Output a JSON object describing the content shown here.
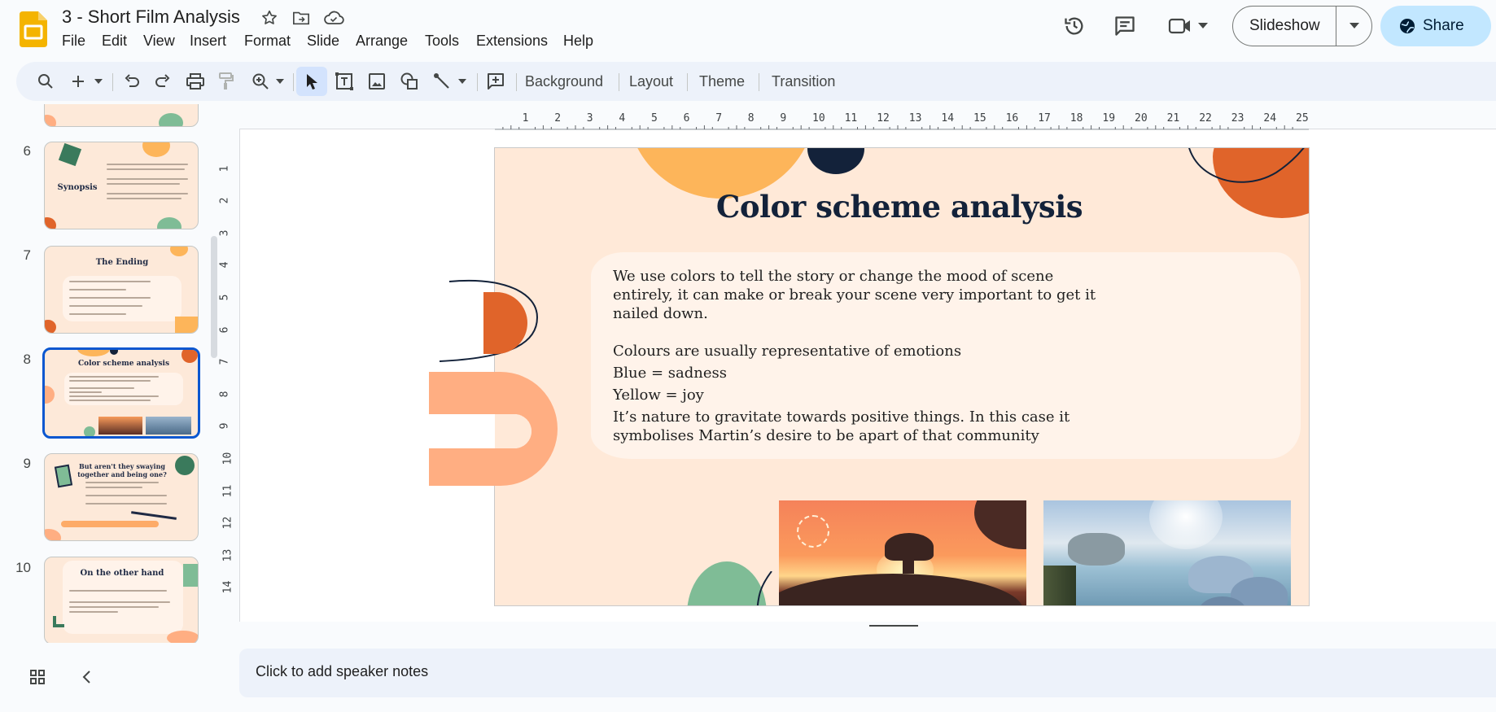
{
  "doc": {
    "title": "3 - Short Film Analysis"
  },
  "menu": [
    "File",
    "Edit",
    "View",
    "Insert",
    "Format",
    "Slide",
    "Arrange",
    "Tools",
    "Extensions",
    "Help"
  ],
  "header": {
    "slideshow_label": "Slideshow",
    "share_label": "Share"
  },
  "toolbar": {
    "background_label": "Background",
    "layout_label": "Layout",
    "theme_label": "Theme",
    "transition_label": "Transition"
  },
  "ruler": {
    "top_ticks": [
      "1",
      "2",
      "3",
      "4",
      "5",
      "6",
      "7",
      "8",
      "9",
      "10",
      "11",
      "12",
      "13",
      "14",
      "15",
      "16",
      "17",
      "18",
      "19",
      "20",
      "21",
      "22",
      "23",
      "24",
      "25"
    ],
    "left_ticks": [
      "1",
      "2",
      "3",
      "4",
      "5",
      "6",
      "7",
      "8",
      "9",
      "10",
      "11",
      "12",
      "13",
      "14"
    ]
  },
  "filmstrip": {
    "slides": [
      {
        "number": "6",
        "title": "Synopsis"
      },
      {
        "number": "7",
        "title": "The Ending"
      },
      {
        "number": "8",
        "title": "Color scheme analysis"
      },
      {
        "number": "9",
        "title": "But aren't they swaying together and being one?"
      },
      {
        "number": "10",
        "title": "On the other hand"
      }
    ]
  },
  "slide": {
    "title": "Color scheme analysis",
    "para1": "We use colors to tell the story or change the mood of  scene entirely, it can make or break your scene very important to get it nailed down.",
    "lines": [
      "Colours are usually representative of emotions",
      "Blue = sadness",
      "Yellow = joy",
      "It’s nature to gravitate towards positive things. In this case it symbolises Martin’s desire to be apart of that community"
    ]
  },
  "notes": {
    "placeholder": "Click to add speaker notes"
  },
  "colors": {
    "accent_blue": "#0b57d0",
    "share_bg": "#c2e7ff",
    "slide_bg": "#ffe9d8",
    "orange": "#e0642a",
    "yellow": "#fdb55a",
    "peach": "#ffae82",
    "green": "#7fbc96",
    "navy": "#13223a"
  }
}
